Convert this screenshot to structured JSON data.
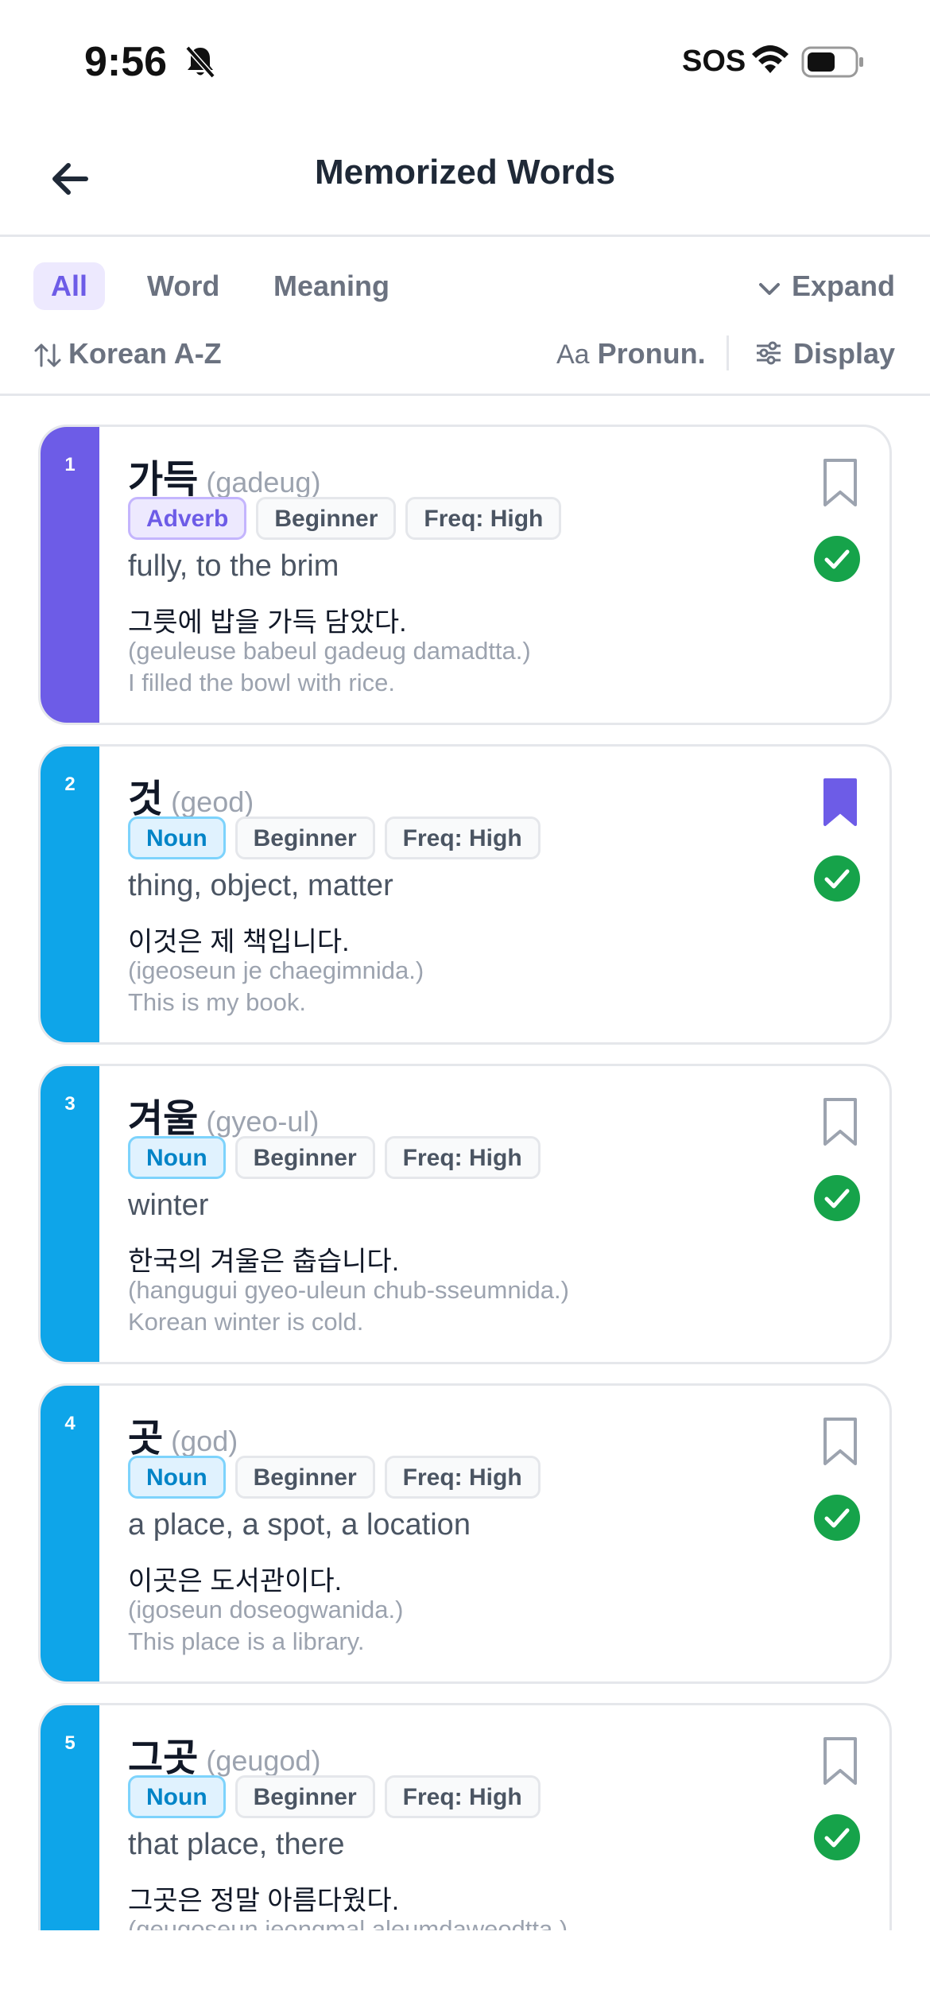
{
  "status_bar": {
    "time": "9:56",
    "carrier": "SOS"
  },
  "header": {
    "title": "Memorized Words"
  },
  "filters": {
    "tabs": [
      {
        "label": "All",
        "active": true
      },
      {
        "label": "Word",
        "active": false
      },
      {
        "label": "Meaning",
        "active": false
      }
    ],
    "expand_label": "Expand",
    "sort_label": "Korean A-Z",
    "pronunciation_prefix": "Aa",
    "pronunciation_label": "Pronun.",
    "display_label": "Display"
  },
  "colors": {
    "accent": "#6d5ce7",
    "noun": "#0ea5e9",
    "adverb": "#6d5ce7",
    "memorized": "#16a34a"
  },
  "cards": [
    {
      "number": "1",
      "word": "가득",
      "romaja": "(gadeug)",
      "pos": "Adverb",
      "level": "Beginner",
      "freq": "Freq: High",
      "meaning": "fully, to the brim",
      "example": "그릇에 밥을 가득 담았다.",
      "example_romaja": "(geuleuse babeul gadeug damadtta.)",
      "example_en": "I filled the bowl with rice.",
      "bookmarked": false,
      "memorized": true
    },
    {
      "number": "2",
      "word": "것",
      "romaja": "(geod)",
      "pos": "Noun",
      "level": "Beginner",
      "freq": "Freq: High",
      "meaning": "thing, object, matter",
      "example": "이것은 제 책입니다.",
      "example_romaja": "(igeoseun je chaegimnida.)",
      "example_en": "This is my book.",
      "bookmarked": true,
      "memorized": true
    },
    {
      "number": "3",
      "word": "겨울",
      "romaja": "(gyeo-ul)",
      "pos": "Noun",
      "level": "Beginner",
      "freq": "Freq: High",
      "meaning": "winter",
      "example": "한국의 겨울은 춥습니다.",
      "example_romaja": "(hangugui gyeo-uleun chub-sseumnida.)",
      "example_en": "Korean winter is cold.",
      "bookmarked": false,
      "memorized": true
    },
    {
      "number": "4",
      "word": "곳",
      "romaja": "(god)",
      "pos": "Noun",
      "level": "Beginner",
      "freq": "Freq: High",
      "meaning": "a place, a spot, a location",
      "example": "이곳은 도서관이다.",
      "example_romaja": "(igoseun doseogwanida.)",
      "example_en": "This place is a library.",
      "bookmarked": false,
      "memorized": true
    },
    {
      "number": "5",
      "word": "그곳",
      "romaja": "(geugod)",
      "pos": "Noun",
      "level": "Beginner",
      "freq": "Freq: High",
      "meaning": "that place, there",
      "example": "그곳은 정말 아름다웠다.",
      "example_romaja": "(geugoseun jeongmal aleumdaweodtta.)",
      "example_en": "",
      "bookmarked": false,
      "memorized": true
    }
  ]
}
